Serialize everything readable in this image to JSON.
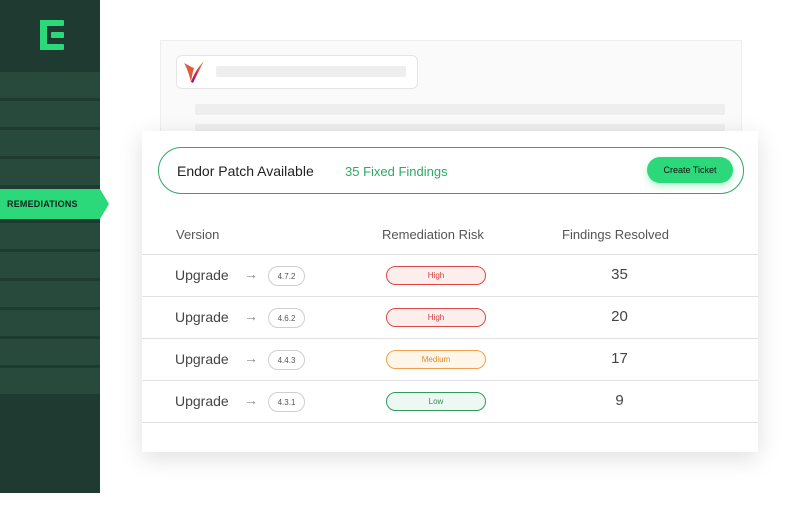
{
  "sidebar": {
    "active_item": "REMEDIATIONS",
    "colors": {
      "background": "#1f3a30",
      "accent": "#2bd97a"
    }
  },
  "banner": {
    "title": "Endor Patch Available",
    "subtitle": "35 Fixed Findings",
    "button_label": "Create Ticket"
  },
  "table": {
    "headers": [
      "Version",
      "Remediation Risk",
      "Findings Resolved"
    ],
    "rows": [
      {
        "action": "Upgrade",
        "version": "4.7.2",
        "risk": "High",
        "findings": "35"
      },
      {
        "action": "Upgrade",
        "version": "4.6.2",
        "risk": "High",
        "findings": "20"
      },
      {
        "action": "Upgrade",
        "version": "4.4.3",
        "risk": "Medium",
        "findings": "17"
      },
      {
        "action": "Upgrade",
        "version": "4.3.1",
        "risk": "Low",
        "findings": "9"
      }
    ]
  },
  "icons": {
    "logo": "endor-logo-icon",
    "package": "apache-feather-icon",
    "arrow": "arrow-right-icon"
  },
  "colors": {
    "high": "#e04848",
    "medium": "#f2a14a",
    "low": "#2e9c5f",
    "banner_border": "#2ea866"
  }
}
